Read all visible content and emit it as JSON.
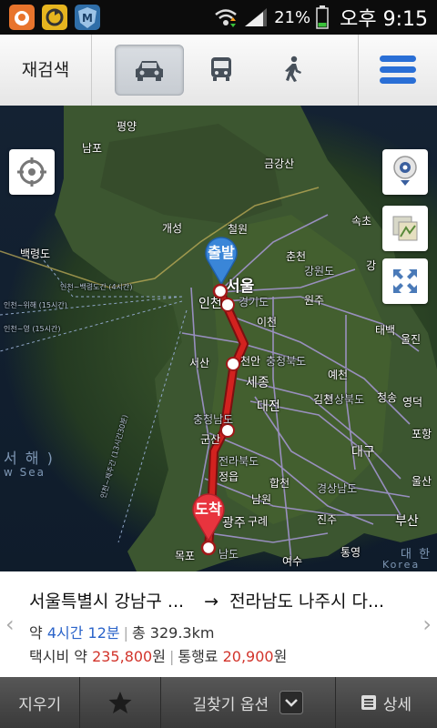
{
  "status_bar": {
    "battery_percent": "21%",
    "ampm": "오후",
    "time": "9:15"
  },
  "toolbar": {
    "research_label": "재검색",
    "modes": [
      "car",
      "transit",
      "walk"
    ],
    "active_mode": "car"
  },
  "map": {
    "cities": {
      "pyeongyang": "평양",
      "nampo": "남포",
      "geumgangsan": "금강산",
      "gaeseong": "개성",
      "cheolwon": "철원",
      "sokcho": "속초",
      "baengnyeongdo": "백령도",
      "chuncheon": "춘천",
      "gangwondo": "강원도",
      "gangneung": "강",
      "seoul": "서울",
      "incheon": "인천",
      "gyeonggido": "경기도",
      "wonju": "원주",
      "icheon": "이천",
      "taebaek": "태백",
      "uljin": "울진",
      "seosan": "서산",
      "cheonan": "천안",
      "chungcheongbukdo": "충청북도",
      "sejong": "세종",
      "yecheon": "예천",
      "daejeon": "대전",
      "gyeongsangbukdo": "경상북도",
      "cheongsong": "청송",
      "yeongdeok": "영덕",
      "chungcheongnamdo": "충청남도",
      "gimcheon": "김천",
      "pohang": "포항",
      "gunsan": "군산",
      "daegu": "대구",
      "jeollabukdo": "전라북도",
      "jeongeup": "정읍",
      "hapcheon": "합천",
      "ulsan": "울산",
      "namwon": "남원",
      "gyeongsangnamdo": "경상남도",
      "gwangju": "광주",
      "gurye": "구례",
      "jinju": "진주",
      "busan": "부산",
      "mokpo": "목포",
      "jeollanamdo": "남도",
      "yeosu": "여수",
      "tongyeong": "통영"
    },
    "sea_west": "서 해 )",
    "sea_west_en": "w Sea",
    "sea_south": "대 한",
    "sea_korea": "Korea",
    "route_labels": {
      "r1": "인천~백령도간 (4시간)",
      "r2": "인천~위해 (15시간)",
      "r3": "인천~영 (15시간)",
      "r4": "인천~제주간 (13시간30분)"
    },
    "start_pin_label": "출발",
    "end_pin_label": "도착",
    "route_color": "#c8201e",
    "buttons": [
      "gps-icon",
      "camera-icon",
      "map-layer-icon",
      "fullscreen-icon"
    ]
  },
  "info": {
    "origin": "서울특별시 강남구 ...",
    "arrow": "→",
    "destination": "전라남도 나주시 다...",
    "time_prefix": "약 ",
    "time_value": "4시간 12분",
    "distance": "총 329.3km",
    "taxi_prefix": "택시비 약 ",
    "taxi_value": "235,800",
    "taxi_unit": "원",
    "toll_prefix": "통행료 ",
    "toll_value": "20,900",
    "toll_unit": "원"
  },
  "bottom_bar": {
    "clear_label": "지우기",
    "options_label": "길찾기 옵션",
    "detail_label": "상세"
  }
}
